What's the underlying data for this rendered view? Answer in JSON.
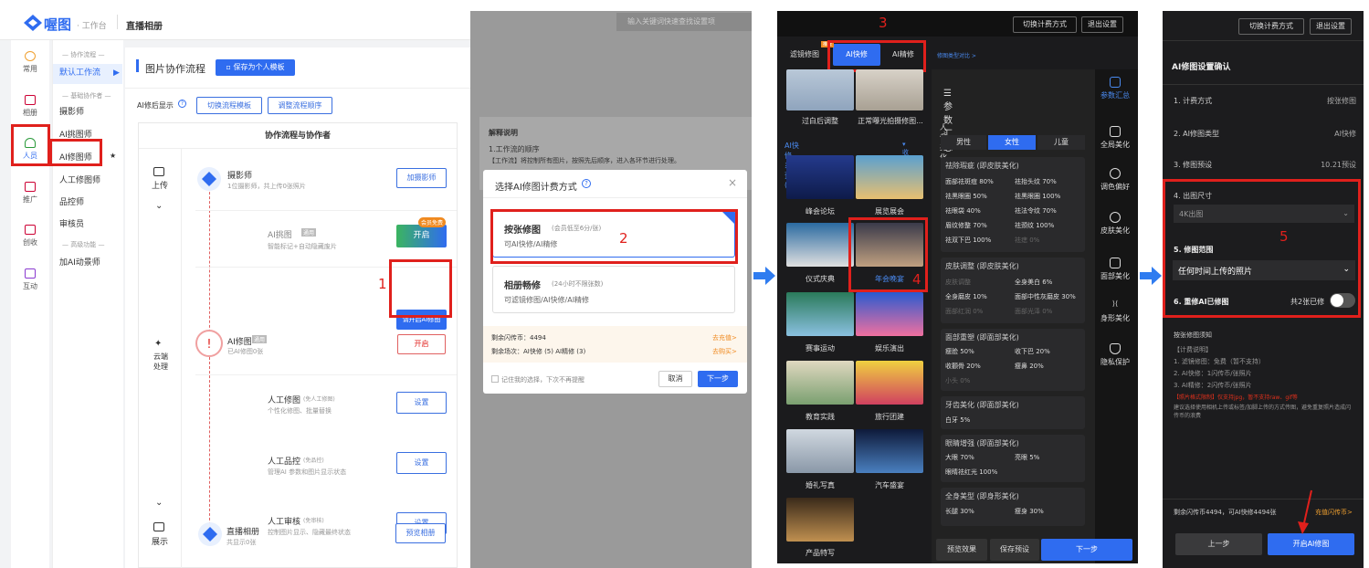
{
  "p1": {
    "logo_text": "喔图",
    "workbench": "· 工作台",
    "album": "直播相册",
    "nav": [
      {
        "label": "常用",
        "icon": "star-icon"
      },
      {
        "label": "相册",
        "icon": "image-icon"
      },
      {
        "label": "人员",
        "icon": "user-icon"
      },
      {
        "label": "推广",
        "icon": "monitor-icon"
      },
      {
        "label": "创收",
        "icon": "money-icon"
      },
      {
        "label": "互动",
        "icon": "chat-icon"
      }
    ],
    "menu": {
      "sec1": "— 协作流程 —",
      "default_flow": "默认工作流",
      "sec2": "— 基础协作者 —",
      "items": [
        "摄影师",
        "AI挑图师",
        "AI修图师",
        "人工修图师",
        "品控师",
        "审核员"
      ],
      "sec3": "— 高级功能 —",
      "extra": "加AI动景师"
    },
    "title": "图片协作流程",
    "save_template": "保存为个人模板",
    "after_ai_label": "AI修后显示",
    "switch_template": "切换流程模板",
    "adjust_order": "调整流程顺序",
    "table_header": "协作流程与协作者",
    "stages": {
      "upload": "上传",
      "cloud": "云端处理",
      "show": "展示"
    },
    "flows": [
      {
        "name": "摄影师",
        "sub": "1位摄影师，共上传0张照片",
        "btn": "加摄影师"
      },
      {
        "name": "AI挑图",
        "tag": "通用",
        "sub": "智能标记+自动隐藏废片",
        "btn": "开启",
        "badge": "会员免费"
      },
      {
        "name": "AI修图",
        "tag": "通用",
        "sub": "已AI修图0张",
        "btn": "开启",
        "tooltip": "请开启AI修图"
      },
      {
        "name": "人工修图",
        "tag": "(免人工修图)",
        "sub": "个性化修图、批量替换",
        "btn": "设置"
      },
      {
        "name": "人工品控",
        "tag": "(免品控)",
        "sub": "管理AI 参数和图片显示状态",
        "btn": "设置"
      },
      {
        "name": "人工审核",
        "tag": "(免审核)",
        "sub": "控制图片显示、隐藏最终状态",
        "btn": "设置"
      },
      {
        "name": "直播相册",
        "sub": "共显示0张",
        "btn": "预览相册"
      }
    ],
    "callout": "1"
  },
  "p2": {
    "search_placeholder": "输入关键词快速查找设置项",
    "explain_title": "解释说明",
    "explain_1": "1.工作流的顺序",
    "explain_2": "【工作流】将控制所有图片，按照先后顺序，进入各环节进行处理。",
    "dialog_title": "选择AI修图计费方式",
    "opt1_title": "按张修图",
    "opt1_price": "(会员低至6分/张)",
    "opt1_desc": "可AI快修/AI精修",
    "callout": "2",
    "opt2_title": "相册畅修",
    "opt2_price": "(24小时不限张数)",
    "opt2_desc": "可滤镜修图/AI快修/AI精修",
    "coins": "剩余闪传币：4494",
    "coins_link": "去充值>",
    "sessions": "剩余场次：AI快修 (5) AI精修 (3)",
    "sessions_link": "去购买>",
    "remember": "记住我的选择，下次不再提醒",
    "cancel": "取消",
    "next": "下一步"
  },
  "p3": {
    "switch_billing": "切换计费方式",
    "exit": "退出设置",
    "callout3": "3",
    "tabs": [
      "滤镜修图",
      "AI快修",
      "AI精修"
    ],
    "tab_badge": "推荐",
    "compare": "修图类型对比 >",
    "top_thumbs": [
      "过白后调整",
      "正常曝光拍摄修图..."
    ],
    "presets_title": "AI快修-系统预设 (11)",
    "collapse": "收起",
    "presets": [
      "峰会论坛",
      "展览展会",
      "仪式庆典",
      "年会晚宴",
      "赛事运动",
      "娱乐演出",
      "教育实践",
      "旅行团建",
      "婚礼写真",
      "汽车盛宴",
      "产品特写"
    ],
    "callout4": "4",
    "params_title": "参数汇总",
    "portrait": "人像美化",
    "genders": [
      "男性",
      "女性",
      "儿童"
    ],
    "groups": [
      {
        "title": "祛除瑕疵 (即皮肤美化)",
        "items": [
          "面部祛斑痘 80%",
          "祛抬头纹 70%",
          "祛黑眼圈 50%",
          "祛黑眼圈 100%",
          "祛眼袋 40%",
          "祛法令纹 70%",
          "眉纹修整 70%",
          "祛颈纹 100%",
          "祛双下巴 100%",
          "祛痣 0%"
        ]
      },
      {
        "title": "皮肤调整 (即皮肤美化)",
        "items": [
          "皮肤调整",
          "全身美白 6%",
          "全身磨皮 10%",
          "面部中性灰磨皮 30%",
          "面部红润 0%",
          "面部光泽 0%"
        ]
      },
      {
        "title": "面部重塑 (即面部美化)",
        "items": [
          "瘦脸 50%",
          "收下巴 20%",
          "收颧骨 20%",
          "瘦鼻 20%",
          "小头 0%"
        ]
      },
      {
        "title": "牙齿美化 (即面部美化)",
        "items": [
          "白牙 5%"
        ]
      },
      {
        "title": "眼睛增强 (即面部美化)",
        "items": [
          "大眼 70%",
          "亮眼 5%",
          "眼睛祛红光 100%"
        ]
      },
      {
        "title": "全身美型 (即身形美化)",
        "items": [
          "长腿 30%",
          "瘦身 30%"
        ]
      }
    ],
    "side": [
      "参数汇总",
      "全局美化",
      "调色偏好",
      "皮肤美化",
      "面部美化",
      "身形美化",
      "隐私保护"
    ],
    "preview": "预览效果",
    "save_preset": "保存预设",
    "next": "下一步"
  },
  "p4": {
    "switch_billing": "切换计费方式",
    "exit": "退出设置",
    "title": "AI修图设置确认",
    "rows": [
      {
        "k": "1. 计费方式",
        "v": "按张修图"
      },
      {
        "k": "2. AI修图类型",
        "v": "AI快修"
      },
      {
        "k": "3. 修图预设",
        "v": "10.21预设"
      }
    ],
    "size_label": "4. 出图尺寸",
    "size_value": "4K出图",
    "range_label": "5. 修图范围",
    "range_value": "任何时间上传的照片",
    "redo_label": "6. 重修AI已修图",
    "redo_value": "共2张已修",
    "callout": "5",
    "notes_title": "按张修图须知",
    "notes": [
      "【计费说明】",
      "1. 滤镜修图：免费（暂不支持）",
      "2. AI快修：1闪传币/张照片",
      "3. AI精修：2闪传币/张照片"
    ],
    "warn": "【照片格式限制】仅支持jpg，暂不支持raw、gif等",
    "tip": "建议选择使用相机上传或标签/加脚上传的方式传图，避免重复照片造成闪传币的浪费",
    "balance": "剩余闪传币4494，可AI快修4494张",
    "recharge": "充值闪传币>",
    "prev": "上一步",
    "start": "开启AI修图"
  }
}
